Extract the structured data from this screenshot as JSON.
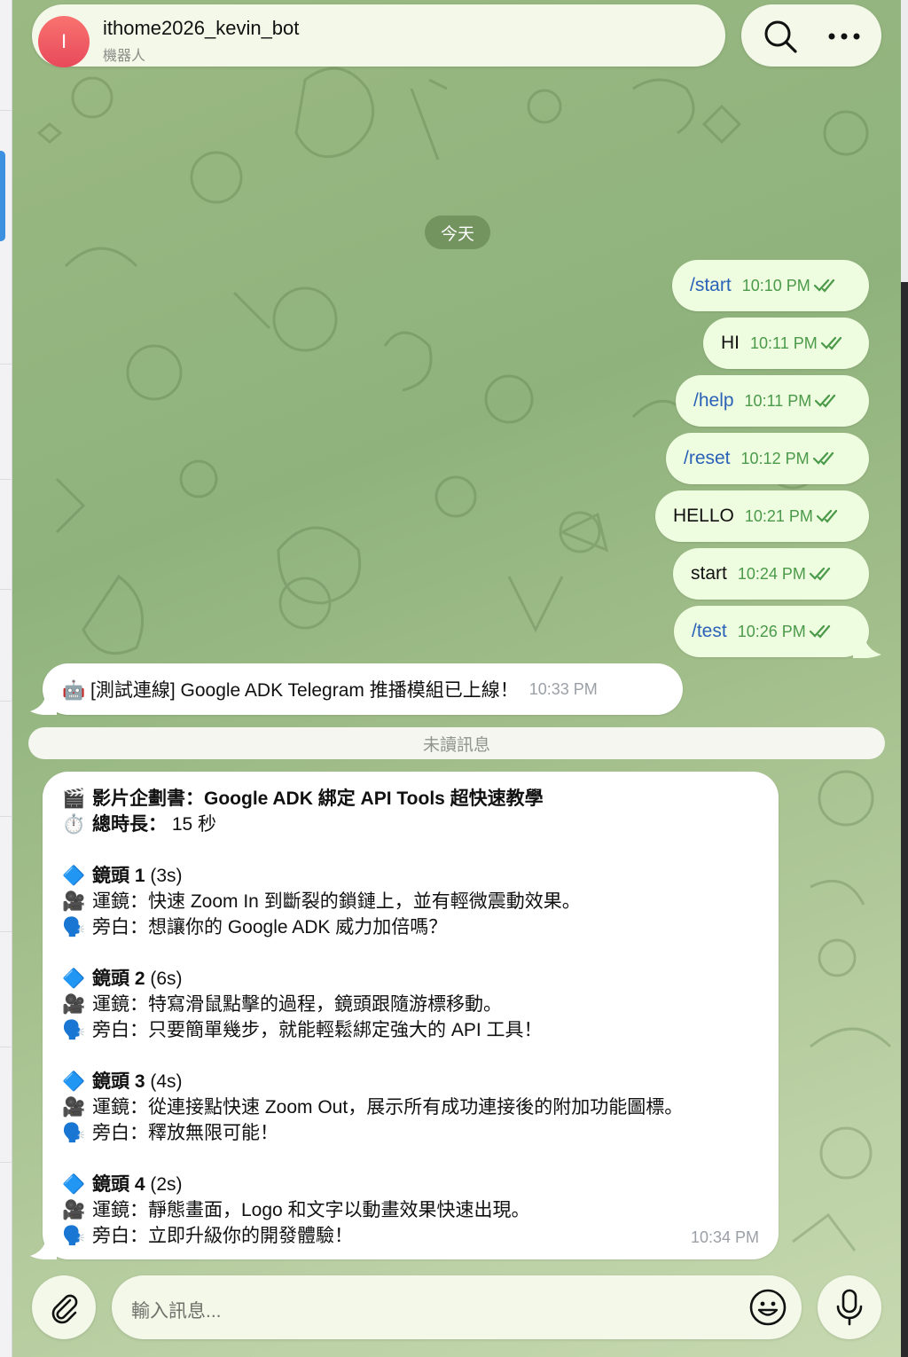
{
  "header": {
    "avatar_letter": "I",
    "bot_name": "ithome2026_kevin_bot",
    "bot_subtitle": "機器人",
    "search_icon": "search-icon",
    "more_icon": "more-dots-icon"
  },
  "date_label": "今天",
  "outgoing": [
    {
      "text": "/start",
      "time": "10:10 PM",
      "is_command": true
    },
    {
      "text": "HI",
      "time": "10:11 PM",
      "is_command": false
    },
    {
      "text": "/help",
      "time": "10:11 PM",
      "is_command": true
    },
    {
      "text": "/reset",
      "time": "10:12 PM",
      "is_command": true
    },
    {
      "text": "HELLO",
      "time": "10:21 PM",
      "is_command": false
    },
    {
      "text": "start",
      "time": "10:24 PM",
      "is_command": false
    },
    {
      "text": "/test",
      "time": "10:26 PM",
      "is_command": true
    }
  ],
  "incoming_1": {
    "emoji": "🤖",
    "text": "[測試連線] Google ADK Telegram 推播模組已上線！",
    "time": "10:33 PM"
  },
  "unread_label": "未讀訊息",
  "incoming_2": {
    "title_emoji": "🎬",
    "title": "影片企劃書：Google ADK 綁定 API Tools 超快速教學",
    "duration_emoji": "⏱️",
    "duration_label": "總時長：",
    "duration_value": " 15 秒",
    "shots": [
      {
        "icon": "🔷",
        "label": "鏡頭 1",
        "dur": " (3s)",
        "cam_icon": "🎥",
        "cam": "運鏡：快速 Zoom In 到斷裂的鎖鏈上，並有輕微震動效果。",
        "voice_icon": "🗣️",
        "voice": "旁白：想讓你的 Google ADK 威力加倍嗎？"
      },
      {
        "icon": "🔷",
        "label": "鏡頭 2",
        "dur": " (6s)",
        "cam_icon": "🎥",
        "cam": "運鏡：特寫滑鼠點擊的過程，鏡頭跟隨游標移動。",
        "voice_icon": "🗣️",
        "voice": "旁白：只要簡單幾步，就能輕鬆綁定強大的 API 工具！"
      },
      {
        "icon": "🔷",
        "label": "鏡頭 3",
        "dur": " (4s)",
        "cam_icon": "🎥",
        "cam": "運鏡：從連接點快速 Zoom Out，展示所有成功連接後的附加功能圖標。",
        "voice_icon": "🗣️",
        "voice": "旁白：釋放無限可能！"
      },
      {
        "icon": "🔷",
        "label": "鏡頭 4",
        "dur": " (2s)",
        "cam_icon": "🎥",
        "cam": "運鏡：靜態畫面，Logo 和文字以動畫效果快速出現。",
        "voice_icon": "🗣️",
        "voice": "旁白：立即升級你的開發體驗！"
      }
    ],
    "time": "10:34 PM"
  },
  "composer": {
    "placeholder": "輸入訊息...",
    "attach_icon": "paperclip-icon",
    "emoji_icon": "smiley-icon",
    "mic_icon": "microphone-icon"
  },
  "colors": {
    "outgoing_bubble": "#eefcdf",
    "command_text": "#2a62b8",
    "check_marks": "#4a9a4a",
    "avatar": "#e8495b"
  }
}
